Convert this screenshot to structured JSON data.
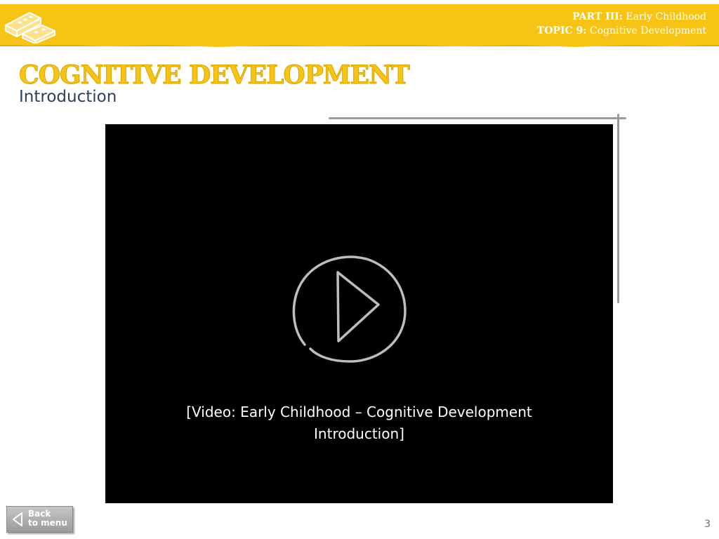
{
  "header": {
    "part_label": "PART III:",
    "part_value": "Early Childhood",
    "topic_label": "TOPIC 9:",
    "topic_value": "Cognitive Development",
    "logo_icon": "building-blocks-icon"
  },
  "title": "COGNITIVE DEVELOPMENT",
  "subtitle": "Introduction",
  "video": {
    "play_icon": "play-icon",
    "caption_line1": "[Video: Early Childhood – Cognitive Development",
    "caption_line2": "Introduction]"
  },
  "footer": {
    "back_line1": "Back",
    "back_line2": "to menu",
    "back_icon": "triangle-left-icon",
    "page_number": "3"
  },
  "colors": {
    "accent_yellow": "#f7c415",
    "subtitle_navy": "#2d3f5f",
    "video_bg": "#000000"
  }
}
